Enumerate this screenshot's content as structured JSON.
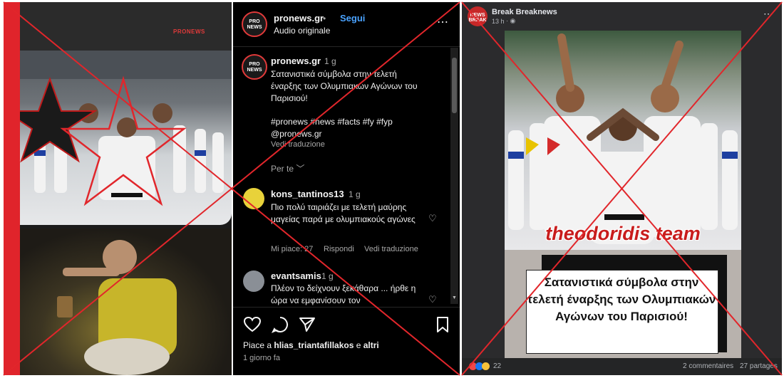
{
  "left_panel": {
    "watermark": "PRONEWS"
  },
  "instagram": {
    "header": {
      "username": "pronews.gr",
      "separator": " • ",
      "follow_label": "Segui",
      "subtitle": "Audio originale",
      "avatar_text": "PRO NEWS",
      "more_icon": "⋯"
    },
    "caption": {
      "username": "pronews.gr",
      "age": "1 g",
      "text": "Σατανιστικά σύμβολα στην τελετή έναρξης των Ολυμπιακών Αγώνων του Παρισιού!",
      "hashtags": "#pronews #news #facts #fy #fyp",
      "mention": "@pronews.gr",
      "translate": "Vedi traduzione"
    },
    "for_you_label": "Per te",
    "comments": [
      {
        "username": "kons_tantinos13",
        "age": "1 g",
        "text": "Πιο πολύ ταιριάζει με τελετή μαύρης μαγείας παρά με ολυμπιακούς αγώνες",
        "likes": "Mi piace: 27",
        "reply": "Rispondi",
        "translate": "Vedi traduzione"
      },
      {
        "username": "evantsamis",
        "age": "1 g",
        "text": "Πλέον το δείχνουν ξεκάθαρα ... ήρθε η ώρα να εμφανίσουν τον"
      }
    ],
    "footer": {
      "likes_prefix": "Piace a ",
      "likes_user": "hlias_triantafillakos",
      "likes_mid": " e ",
      "likes_suffix": "altri",
      "time": "1 giorno fa"
    }
  },
  "facebook": {
    "page_name": "Break Breaknews",
    "time": "13 h",
    "avatar_text": "NEWS BREAK",
    "more_icon": "⋯",
    "image_banner": "theodoridis team",
    "image_headline": "Σατανιστικά σύμβολα στην τελετή έναρξης των Ολυμπιακών Αγώνων του Παρισιού!",
    "reactions_count": "22",
    "comments_count": "2 commentaires",
    "shares_count": "27 partages"
  },
  "colors": {
    "cross_red": "#e1262b",
    "ig_link_blue": "#4aa3ff",
    "fb_dark": "#2b2b2d"
  }
}
